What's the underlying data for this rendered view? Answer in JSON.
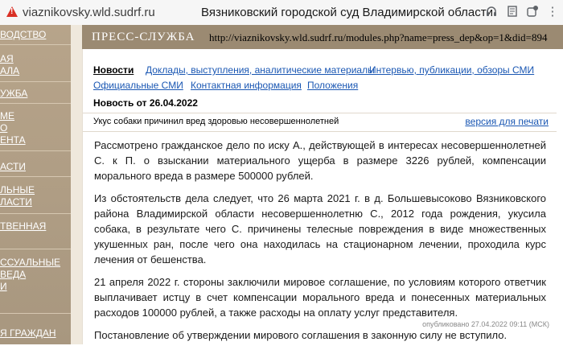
{
  "browser": {
    "url": "viaznikovsky.wld.sudrf.ru",
    "title": "Вязниковский городской суд Владимирской области"
  },
  "sidebar": {
    "items": [
      "ВОДСТВО",
      "АЯ\nАЛА",
      "УЖБА",
      "МЕ\nО\nЕНТА",
      "АСТИ",
      "ЛЬНЫЕ\nЛАСТИ",
      "ТВЕННАЯ",
      "ССУАЛЬНЫЕ\nВЕДА\nИ",
      "Я ГРАЖДАН"
    ]
  },
  "header": {
    "title": "ПРЕСС-СЛУЖБА",
    "url": "http://viaznikovsky.wld.sudrf.ru/modules.php?name=press_dep&op=1&did=894"
  },
  "tabs": [
    "Новости",
    "Доклады, выступления, аналитические материалы",
    "Интервью, публикации, обзоры СМИ",
    "Официальные СМИ",
    "Контактная информация",
    "Положения"
  ],
  "news": {
    "date_label": "Новость от 26.04.2022",
    "title": "Укус собаки причинил вред здоровью несовершеннолетней",
    "print_link": "версия для печати",
    "paragraphs": [
      "Рассмотрено гражданское дело по иску А., действующей в интересах несовершеннолетней С. к П. о взыскании материального ущерба в размере 3226 рублей, компенсации морального вреда в размере 500000 рублей.",
      "Из обстоятельств дела следует, что 26 марта 2021 г. в д. Большевысоково Вязниковского района Владимирской области несовершеннолетню С., 2012 года рождения, укусила собака, в результате чего С. причинены телесные повреждения в виде множественных укушенных ран, после чего она находилась на стационарном лечении, проходила курс лечения от бешенства.",
      "21 апреля 2022 г. стороны заключили мировое соглашение, по условиям которого ответчик выплачивает истцу в счет компенсации морального вреда и понесенных материальных расходов 100000 рублей, а также расходы на оплату услуг представителя.",
      "Постановление об утверждении мирового соглашения в законную силу не вступило."
    ],
    "published": "опубликовано 27.04.2022 09:11 (МСК)"
  }
}
